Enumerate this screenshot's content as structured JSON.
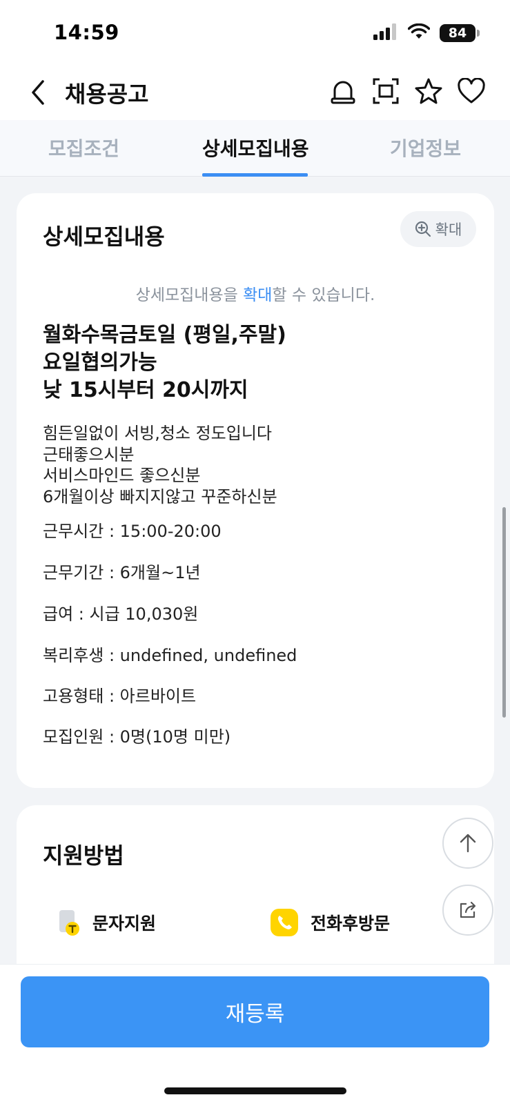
{
  "status": {
    "time": "14:59",
    "battery": "84"
  },
  "header": {
    "title": "채용공고"
  },
  "tabs": [
    {
      "label": "모집조건"
    },
    {
      "label": "상세모집내용"
    },
    {
      "label": "기업정보"
    }
  ],
  "detail": {
    "title": "상세모집내용",
    "zoom_label": "확대",
    "hint_before": "상세모집내용을 ",
    "hint_accent": "확대",
    "hint_after": "할 수 있습니다.",
    "headline": [
      "월화수목금토일 (평일,주말)",
      "요일협의가능",
      "낮 15시부터 20시까지"
    ],
    "body": [
      "힘든일없이 서빙,청소 정도입니다",
      "근태좋으시분",
      "서비스마인드 좋으신분",
      "6개월이상 빠지지않고 꾸준하신분"
    ],
    "fields": [
      "근무시간 : 15:00-20:00",
      "근무기간 : 6개월~1년",
      "급여 : 시급 10,030원",
      "복리후생 : undefined, undefined",
      "고용형태 : 아르바이트",
      "모집인원 : 0명(10명 미만)"
    ]
  },
  "apply": {
    "title": "지원방법",
    "methods": [
      {
        "label": "문자지원",
        "icon": "sms-apply-icon"
      },
      {
        "label": "전화후방문",
        "icon": "phone-icon"
      }
    ]
  },
  "cta": {
    "label": "재등록"
  },
  "colors": {
    "accent": "#3b94f5",
    "tab_inactive": "#a7b1bd",
    "phone_yellow": "#ffd400"
  }
}
